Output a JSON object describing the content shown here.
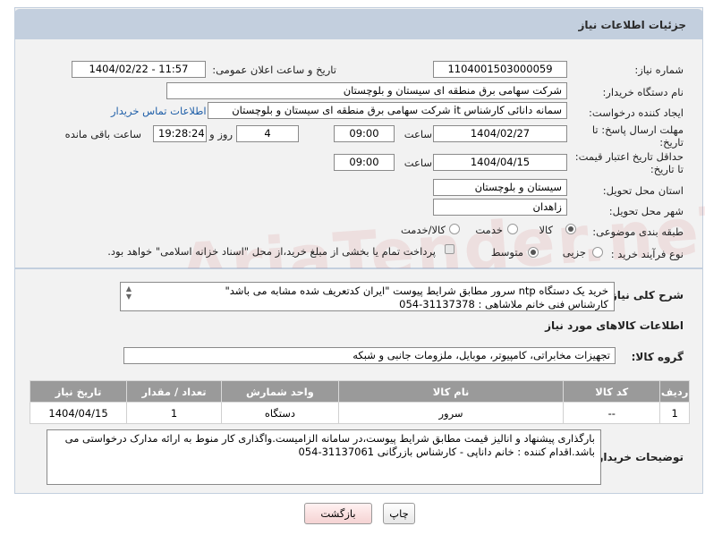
{
  "header": {
    "title": "جزئیات اطلاعات نیاز"
  },
  "fields": {
    "need_number_label": "شماره نیاز:",
    "need_number": "1104001503000059",
    "announce_label": "تاریخ و ساعت اعلان عمومی:",
    "announce_value": "1404/02/22 - 11:57",
    "buyer_org_label": "نام دستگاه خریدار:",
    "buyer_org": "شرکت سهامی برق منطقه ای سیستان و بلوچستان",
    "creator_label": "ایجاد کننده درخواست:",
    "creator": "سمانه دانائی کارشناس it شرکت سهامی برق منطقه ای سیستان و بلوچستان",
    "contact_link": "اطلاعات تماس خریدار",
    "deadline_label_1": "مهلت ارسال پاسخ: تا",
    "deadline_label_2": "تاریخ:",
    "deadline_date": "1404/02/27",
    "time_label": "ساعت",
    "deadline_time": "09:00",
    "days_value": "4",
    "days_label": "روز و",
    "remaining_time": "19:28:24",
    "remaining_label": "ساعت باقی مانده",
    "validity_label_1": "حداقل تاریخ اعتبار قیمت:",
    "validity_label_2": "تا تاریخ:",
    "validity_date": "1404/04/15",
    "validity_time": "09:00",
    "province_label": "استان محل تحویل:",
    "province": "سیستان و بلوچستان",
    "city_label": "شهر محل تحویل:",
    "city": "زاهدان",
    "category_label": "طبقه بندی موضوعی:",
    "category_options": [
      "کالا",
      "خدمت",
      "کالا/خدمت"
    ],
    "purchase_label": "نوع فرآیند خرید :",
    "purchase_options": [
      "جزیی",
      "متوسط"
    ],
    "payment_note": "پرداخت تمام یا بخشی از مبلغ خرید،از محل \"اسناد خزانه اسلامی\" خواهد بود."
  },
  "description": {
    "label": "شرح کلی نیاز:",
    "text": "خرید یک دستگاه ntp سرور مطابق شرایط پیوست \"ایران کدتعریف شده مشابه می باشد\"\nکارشناس فنی خانم ملاشاهی : 31137378-054"
  },
  "goods": {
    "section_title": "اطلاعات کالاهای مورد نیاز",
    "group_label": "گروه کالا:",
    "group_value": "تجهیزات مخابراتی، کامپیوتر، موبایل، ملزومات جانبی و شبکه",
    "columns": [
      "ردیف",
      "کد کالا",
      "نام کالا",
      "واحد شمارش",
      "تعداد / مقدار",
      "تاریخ نیاز"
    ],
    "rows": [
      [
        "1",
        "--",
        "سرور",
        "دستگاه",
        "1",
        "1404/04/15"
      ]
    ]
  },
  "buyer_notes": {
    "label": "توضیحات خریدار:",
    "text": "بارگذاری پیشنهاد و انالیز قیمت مطابق شرایط پیوست،در سامانه الزامیست.واگذاری کار منوط به ارائه مدارک درخواستی می باشد.اقدام کننده : خانم داناپی - کارشناس بازرگانی 31137061-054"
  },
  "buttons": {
    "print": "چاپ",
    "back": "بازگشت"
  },
  "watermark": "AriaTender.neT"
}
